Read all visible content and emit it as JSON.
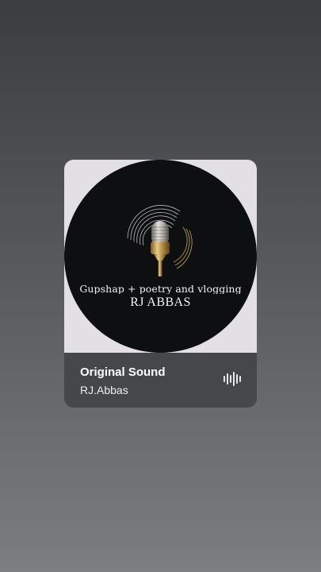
{
  "sound_card": {
    "artwork": {
      "tagline": "Gupshap + poetry and vlogging",
      "brand": "RJ ABBAS",
      "icon": "microphone-icon"
    },
    "title": "Original Sound",
    "artist": "RJ.Abbas",
    "waveform_icon": "sound-wave-icon"
  },
  "colors": {
    "background_top": "#3b3d41",
    "background_bottom": "#7d7e81",
    "card_info_bg": "#46474b",
    "artwork_bg": "#e2e0e4",
    "disc": "#0e0f11",
    "mic_gold": "#c9a55a"
  }
}
